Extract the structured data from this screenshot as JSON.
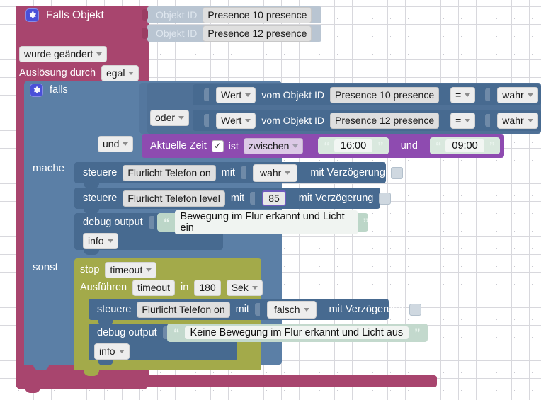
{
  "app": {
    "kind": "blockly-visual-script-editor",
    "language": "de"
  },
  "colors": {
    "trigger": "#a8456e",
    "control": "#5b7fa6",
    "time": "#8e4bb0",
    "timeout": "#a3aa4a",
    "text": "#bcd6c8",
    "gear": "#4a50d8",
    "canvas": "#ffffff",
    "grid_dot": "#c9c9d0"
  },
  "trigger": {
    "icon": "gear-icon",
    "title": "Falls Objekt",
    "objects": [
      {
        "label": "Objekt ID",
        "value": "Presence 10 presence"
      },
      {
        "label": "Objekt ID",
        "value": "Presence 12 presence"
      }
    ],
    "change_mode": "wurde geändert",
    "source_label": "Auslösung durch",
    "source_value": "egal"
  },
  "if_block": {
    "icon": "gear-icon",
    "keyword": "falls",
    "do_label": "mache",
    "else_label": "sonst",
    "logic": {
      "or_operator": "oder",
      "and_operator": "und",
      "conditions": [
        {
          "getter": "Wert",
          "of_label": "vom Objekt ID",
          "object": "Presence 10 presence",
          "comparator": "=",
          "value": "wahr"
        },
        {
          "getter": "Wert",
          "of_label": "vom Objekt ID",
          "object": "Presence 12 presence",
          "comparator": "=",
          "value": "wahr"
        }
      ],
      "time_condition": {
        "label": "Aktuelle Zeit",
        "checkbox_checked": true,
        "is_label": "ist",
        "operator": "zwischen",
        "start": "16:00",
        "join": "und",
        "end": "09:00"
      }
    }
  },
  "do_statements": [
    {
      "type": "control",
      "verb": "steuere",
      "object": "Flurlicht Telefon on",
      "with_label": "mit",
      "value": "wahr",
      "value_kind": "dropdown",
      "delay_label": "mit Verzögerung",
      "delay_checked": false
    },
    {
      "type": "control",
      "verb": "steuere",
      "object": "Flurlicht Telefon level",
      "with_label": "mit",
      "value": "85",
      "value_kind": "number",
      "delay_label": "mit Verzögerung",
      "delay_checked": false
    },
    {
      "type": "debug",
      "verb": "debug output",
      "text": "Bewegung im Flur erkannt und Licht ein",
      "level": "info"
    }
  ],
  "else_statements": {
    "stop": {
      "verb": "stop",
      "target": "timeout"
    },
    "schedule": {
      "verb": "Ausführen",
      "name": "timeout",
      "in_label": "in",
      "amount": "180",
      "unit": "Sek"
    },
    "body": [
      {
        "type": "control",
        "verb": "steuere",
        "object": "Flurlicht Telefon on",
        "with_label": "mit",
        "value": "falsch",
        "value_kind": "dropdown",
        "delay_label": "mit Verzögerung",
        "delay_checked": false
      },
      {
        "type": "debug",
        "verb": "debug output",
        "text": "Keine Bewegung im Flur erkannt und Licht aus",
        "level": "info"
      }
    ]
  }
}
